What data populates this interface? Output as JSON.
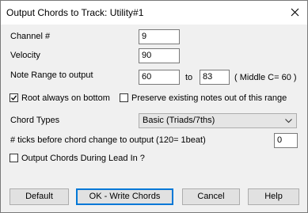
{
  "window": {
    "title": "Output Chords to Track: Utility#1",
    "close_glyph": "close-icon"
  },
  "fields": {
    "channel": {
      "label": "Channel #",
      "value": "9"
    },
    "velocity": {
      "label": "Velocity",
      "value": "90"
    },
    "note_range": {
      "label": "Note Range to output",
      "from": "60",
      "to_label": "to",
      "to": "83",
      "hint": "( Middle C= 60 )"
    },
    "root_bottom": {
      "label": "Root always on bottom",
      "checked": true
    },
    "preserve": {
      "label": "Preserve existing notes out of this range",
      "checked": false
    },
    "chord_types": {
      "label": "Chord Types",
      "value": "Basic (Triads/7ths)"
    },
    "ticks": {
      "label": "# ticks before chord change to output (120= 1beat)",
      "value": "0"
    },
    "lead_in": {
      "label": "Output Chords During Lead In ?",
      "checked": false
    }
  },
  "buttons": {
    "default": "Default",
    "ok": "OK - Write Chords",
    "cancel": "Cancel",
    "help": "Help"
  }
}
